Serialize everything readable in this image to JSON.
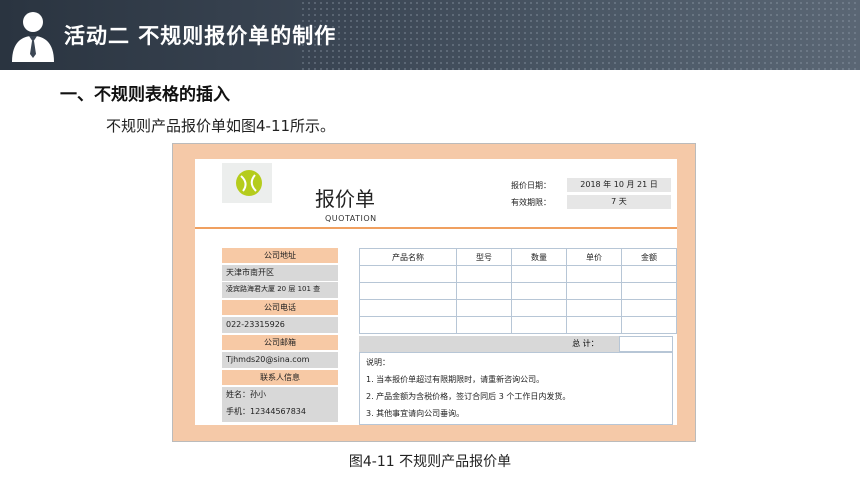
{
  "header": {
    "title": "活动二  不规则报价单的制作"
  },
  "section": {
    "title": "一、不规则表格的插入",
    "desc": "不规则产品报价单如图4-11所示。"
  },
  "caption": "图4-11  不规则产品报价单",
  "doc": {
    "title": "报价单",
    "subtitle": "QUOTATION",
    "date_label": "报价日期：",
    "date_value": "2018 年 10 月 21 日",
    "valid_label": "有效期限：",
    "valid_value": "7 天",
    "left": {
      "addr_label": "公司地址",
      "addr_line1": "天津市南开区",
      "addr_line2": "凌宾路海君大厦 20 层 101 查",
      "phone_label": "公司电话",
      "phone": "022-23315926",
      "email_label": "公司邮箱",
      "email": "Tjhmds20@sina.com",
      "contact_label": "联系人信息",
      "contact_name": "姓名：孙小",
      "contact_phone": "手机：12344567834"
    },
    "table_headers": [
      "产品名称",
      "型号",
      "数量",
      "单价",
      "金额"
    ],
    "total_label": "总    计：",
    "notes": [
      "说明：",
      "1.  当本报价单超过有限期限时，请重新咨询公司。",
      "2.  产品金额为含税价格，签订合同后 3 个工作日内发货。",
      "3.  其他事宜请向公司垂询。"
    ]
  },
  "colors": {
    "accent": "#f0a060",
    "peach": "#f7c9a5",
    "header_bg": "#3b4654"
  }
}
